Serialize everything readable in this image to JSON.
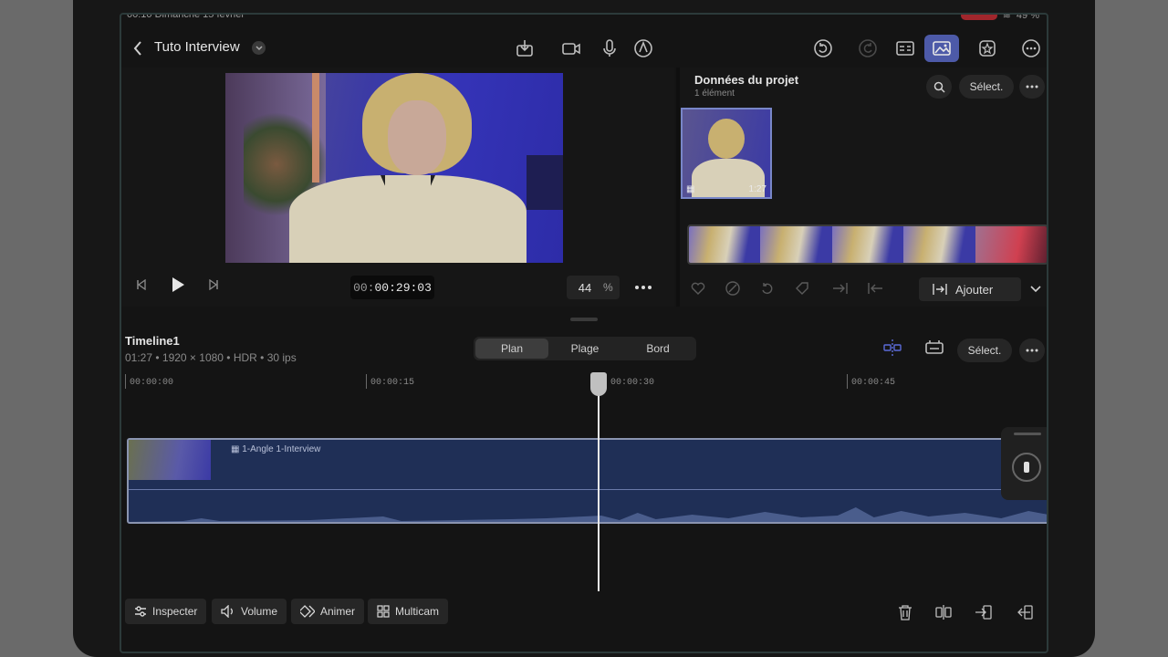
{
  "status": {
    "time_date": "00:10  Dimanche 15 février",
    "battery": "49 %"
  },
  "project": {
    "title": "Tuto Interview"
  },
  "viewer": {
    "timecode_dim": "00:",
    "timecode_main": "00:29:03",
    "zoom_value": "44",
    "zoom_unit": "%"
  },
  "browser": {
    "title": "Données du projet",
    "subtitle": "1 élément",
    "select_label": "Sélect.",
    "thumb_duration": "1:27",
    "add_label": "Ajouter"
  },
  "timeline": {
    "name": "Timeline1",
    "meta": "01:27 • 1920 × 1080 • HDR • 30 ips",
    "modes": [
      "Plan",
      "Plage",
      "Bord"
    ],
    "active_mode": "Plan",
    "select_label": "Sélect.",
    "ruler": [
      "00:00:00",
      "00:00:15",
      "00:00:30",
      "00:00:45"
    ],
    "clip_label": "1-Angle 1-Interview"
  },
  "bottom": {
    "inspect": "Inspecter",
    "volume": "Volume",
    "animate": "Animer",
    "multicam": "Multicam"
  },
  "colors": {
    "accent": "#4d5aa8",
    "clip": "#1f2f56"
  }
}
